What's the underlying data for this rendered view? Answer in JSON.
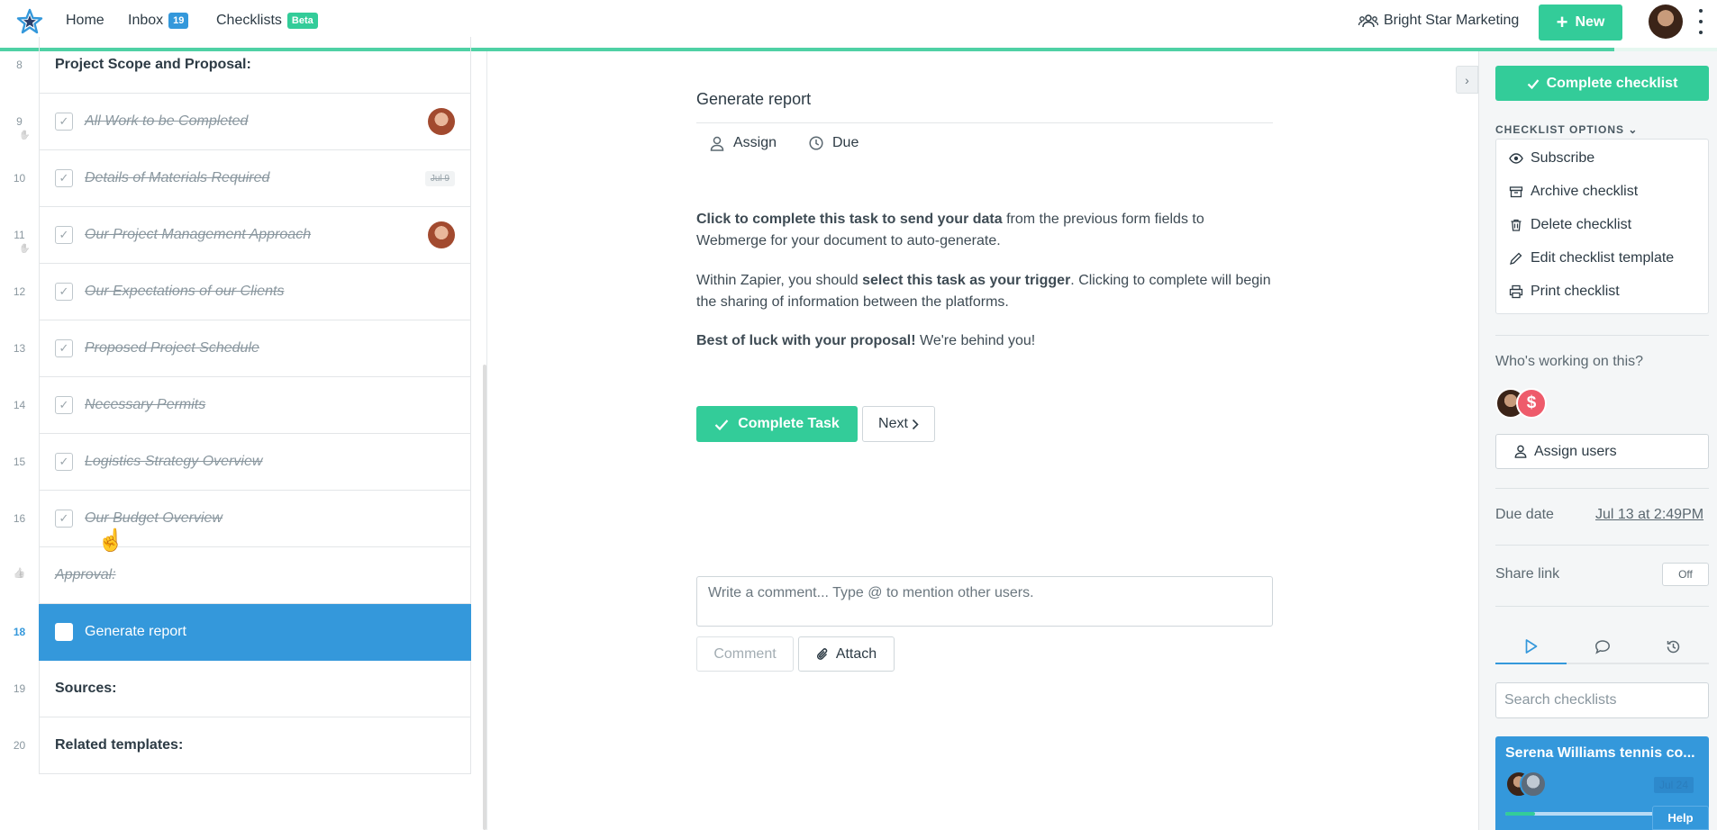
{
  "topbar": {
    "nav": {
      "home": "Home",
      "inbox": "Inbox",
      "inbox_count": "19",
      "checklists": "Checklists",
      "checklists_badge": "Beta"
    },
    "org_name": "Bright Star Marketing",
    "new_button": "New",
    "progress_fraction": 0.94
  },
  "task_list": {
    "rows": [
      {
        "num": "8",
        "label": "Project Scope and Proposal:",
        "kind": "heading"
      },
      {
        "num": "9",
        "label": "All Work to be Completed",
        "kind": "done",
        "extra": "avatar"
      },
      {
        "num": "10",
        "label": "Details of Materials Required",
        "kind": "done",
        "extra": "date",
        "date": "Jul 9"
      },
      {
        "num": "11",
        "label": "Our Project Management Approach",
        "kind": "done",
        "extra": "avatar"
      },
      {
        "num": "12",
        "label": "Our Expectations of our Clients",
        "kind": "done"
      },
      {
        "num": "13",
        "label": "Proposed Project Schedule",
        "kind": "done"
      },
      {
        "num": "14",
        "label": "Necessary Permits",
        "kind": "done"
      },
      {
        "num": "15",
        "label": "Logistics Strategy Overview",
        "kind": "done"
      },
      {
        "num": "16",
        "label": "Our Budget Overview",
        "kind": "done"
      },
      {
        "num": "",
        "label": "Approval:",
        "kind": "approval"
      },
      {
        "num": "18",
        "label": "Generate report",
        "kind": "active"
      },
      {
        "num": "19",
        "label": "Sources:",
        "kind": "heading"
      },
      {
        "num": "20",
        "label": "Related templates:",
        "kind": "heading"
      }
    ]
  },
  "task": {
    "title": "Generate report",
    "assign": "Assign",
    "due": "Due",
    "p1_bold": "Click to complete this task to send your data",
    "p1_rest": " from the previous form fields to Webmerge for your document to auto-generate.",
    "p2_start": "Within Zapier, you should ",
    "p2_bold": "select this task as your trigger",
    "p2_rest": ". Clicking to complete will begin the sharing of information between the platforms.",
    "p3_bold": "Best of luck with your proposal!",
    "p3_rest": " We're behind you!",
    "complete_button": "Complete Task",
    "next_button": "Next",
    "comment_placeholder": "Write a comment... Type @ to mention other users.",
    "comment_button": "Comment",
    "attach_button": "Attach"
  },
  "sidebar": {
    "complete_checklist": "Complete checklist",
    "options_label": "CHECKLIST OPTIONS",
    "options": {
      "subscribe": "Subscribe",
      "archive": "Archive checklist",
      "delete": "Delete checklist",
      "edit_template": "Edit checklist template",
      "print": "Print checklist"
    },
    "working_label": "Who's working on this?",
    "assign_users": "Assign users",
    "due_label": "Due date",
    "due_value": "Jul 13 at 2:49PM",
    "share_label": "Share link",
    "share_state": "Off",
    "search_placeholder": "Search checklists",
    "card": {
      "title": "Serena Williams tennis co...",
      "date": "Jul 24",
      "progress_fraction": 0.2
    },
    "help": "Help"
  },
  "colors": {
    "accent_green": "#33cc99",
    "accent_blue": "#3498db"
  }
}
